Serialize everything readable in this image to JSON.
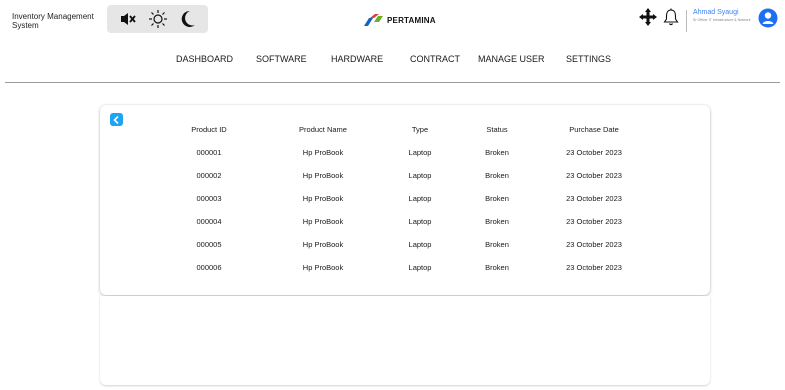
{
  "header": {
    "app_title": "Inventory Management System",
    "toggles": [
      "mute-icon",
      "sun-icon",
      "moon-icon"
    ],
    "logo_text": "PERTAMINA",
    "user": {
      "name": "Ahmad Syaugi",
      "role": "Sr Officer IT Infrastructure & Network"
    },
    "accent": "#3b82f6"
  },
  "nav": {
    "items": [
      "DASHBOARD",
      "SOFTWARE",
      "HARDWARE",
      "CONTRACT",
      "MANAGE USER",
      "SETTINGS"
    ]
  },
  "table": {
    "columns": [
      "Product ID",
      "Product Name",
      "Type",
      "Status",
      "Purchase Date"
    ],
    "rows": [
      [
        "000001",
        "Hp ProBook",
        "Laptop",
        "Broken",
        "23 October 2023"
      ],
      [
        "000002",
        "Hp ProBook",
        "Laptop",
        "Broken",
        "23 October 2023"
      ],
      [
        "000003",
        "Hp ProBook",
        "Laptop",
        "Broken",
        "23 October 2023"
      ],
      [
        "000004",
        "Hp ProBook",
        "Laptop",
        "Broken",
        "23 October 2023"
      ],
      [
        "000005",
        "Hp ProBook",
        "Laptop",
        "Broken",
        "23 October 2023"
      ],
      [
        "000006",
        "Hp ProBook",
        "Laptop",
        "Broken",
        "23 October 2023"
      ]
    ]
  },
  "colors": {
    "back_button": "#1fa3f5",
    "logo_blue": "#1565c0",
    "logo_green": "#6ab023",
    "logo_red": "#e53935"
  }
}
